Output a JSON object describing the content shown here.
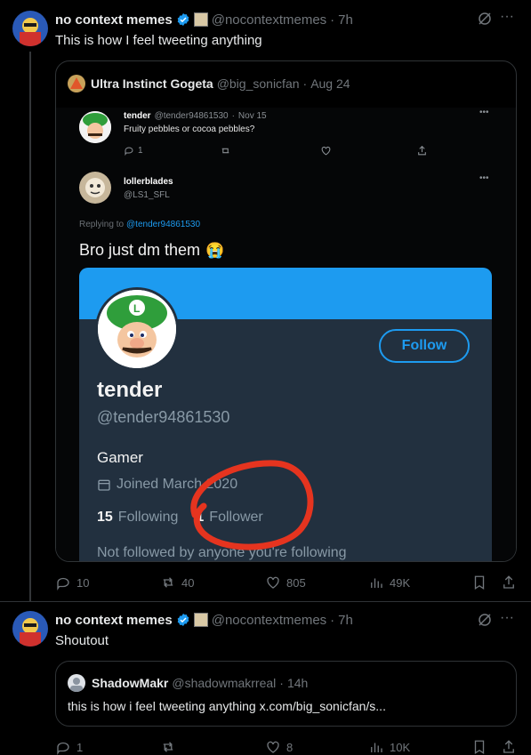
{
  "tweet1": {
    "display_name": "no context memes",
    "handle": "@nocontextmemes",
    "sep": "·",
    "time": "7h",
    "text": "This is how I feel tweeting anything",
    "quote": {
      "display_name": "Ultra Instinct Gogeta",
      "handle": "@big_sonicfan",
      "sep": "·",
      "date": "Aug 24",
      "image": {
        "post1": {
          "name": "tender",
          "handle": "@tender94861530",
          "sep": "·",
          "date": "Nov 15",
          "text": "Fruity pebbles or cocoa pebbles?",
          "reply_count": "1"
        },
        "post2": {
          "name": "lollerblades",
          "handle": "@LS1_SFL",
          "replying_prefix": "Replying to",
          "replying_to": "@tender94861530",
          "text": "Bro just dm them",
          "emoji": "😭"
        },
        "profile": {
          "name": "tender",
          "handle": "@tender94861530",
          "bio": "Gamer",
          "joined": "Joined March 2020",
          "following_count": "15",
          "following_label": "Following",
          "follower_count": "1",
          "follower_label": "Follower",
          "footer": "Not followed by anyone you're following",
          "follow_button": "Follow"
        }
      }
    },
    "actions": {
      "replies": "10",
      "retweets": "40",
      "likes": "805",
      "views": "49K"
    }
  },
  "tweet2": {
    "display_name": "no context memes",
    "handle": "@nocontextmemes",
    "sep": "·",
    "time": "7h",
    "text": "Shoutout",
    "quote": {
      "display_name": "ShadowMakr",
      "handle": "@shadowmakrreal",
      "sep": "·",
      "time": "14h",
      "text": "this is how i feel tweeting anything x.com/big_sonicfan/s..."
    },
    "actions": {
      "replies": "1",
      "retweets": "",
      "likes": "8",
      "views": "10K"
    }
  },
  "colors": {
    "accent": "#1d9bf0",
    "muted": "#71767b",
    "circle": "#e5341f"
  }
}
